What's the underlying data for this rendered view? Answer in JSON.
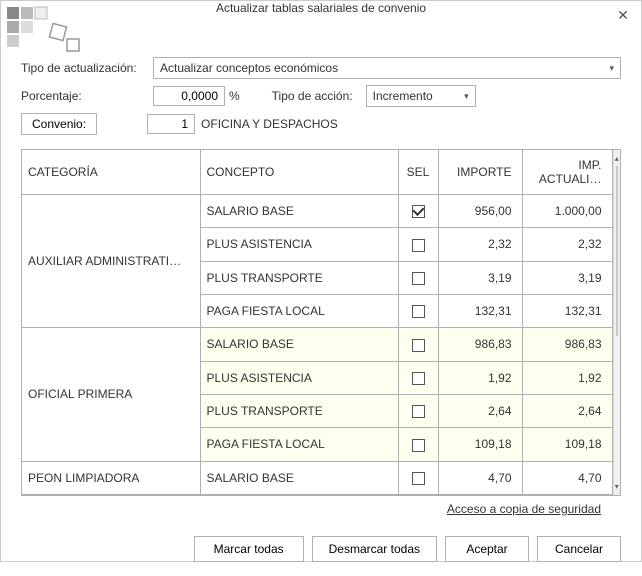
{
  "title": "Actualizar tablas salariales de convenio",
  "form": {
    "tipo_label": "Tipo de actualización:",
    "tipo_value": "Actualizar conceptos económicos",
    "porcentaje_label": "Porcentaje:",
    "porcentaje_value": "0,0000",
    "porcentaje_unit": "%",
    "accion_label": "Tipo de acción:",
    "accion_value": "Incremento",
    "convenio_btn": "Convenio:",
    "convenio_num": "1",
    "convenio_text": "OFICINA Y DESPACHOS"
  },
  "headers": {
    "categoria": "CATEGORÍA",
    "concepto": "CONCEPTO",
    "sel": "SEL",
    "importe": "IMPORTE",
    "actuali": "IMP. ACTUALI…"
  },
  "groups": [
    {
      "categoria": "AUXILIAR ADMINISTRATI…",
      "hl": false,
      "rows": [
        {
          "concepto": "SALARIO BASE",
          "sel": true,
          "importe": "956,00",
          "act": "1.000,00"
        },
        {
          "concepto": "PLUS ASISTENCIA",
          "sel": false,
          "importe": "2,32",
          "act": "2,32"
        },
        {
          "concepto": "PLUS TRANSPORTE",
          "sel": false,
          "importe": "3,19",
          "act": "3,19"
        },
        {
          "concepto": "PAGA FIESTA LOCAL",
          "sel": false,
          "importe": "132,31",
          "act": "132,31"
        }
      ]
    },
    {
      "categoria": "OFICIAL PRIMERA",
      "hl": true,
      "rows": [
        {
          "concepto": "SALARIO BASE",
          "sel": false,
          "importe": "986,83",
          "act": "986,83"
        },
        {
          "concepto": "PLUS ASISTENCIA",
          "sel": false,
          "importe": "1,92",
          "act": "1,92"
        },
        {
          "concepto": "PLUS TRANSPORTE",
          "sel": false,
          "importe": "2,64",
          "act": "2,64"
        },
        {
          "concepto": "PAGA FIESTA LOCAL",
          "sel": false,
          "importe": "109,18",
          "act": "109,18"
        }
      ]
    },
    {
      "categoria": "PEON LIMPIADORA",
      "hl": false,
      "rows": [
        {
          "concepto": "SALARIO BASE",
          "sel": false,
          "importe": "4,70",
          "act": "4,70"
        }
      ]
    }
  ],
  "footer_link": "Acceso a copia de seguridad",
  "buttons": {
    "marcar": "Marcar todas",
    "desmarcar": "Desmarcar todas",
    "aceptar": "Aceptar",
    "cancelar": "Cancelar"
  }
}
